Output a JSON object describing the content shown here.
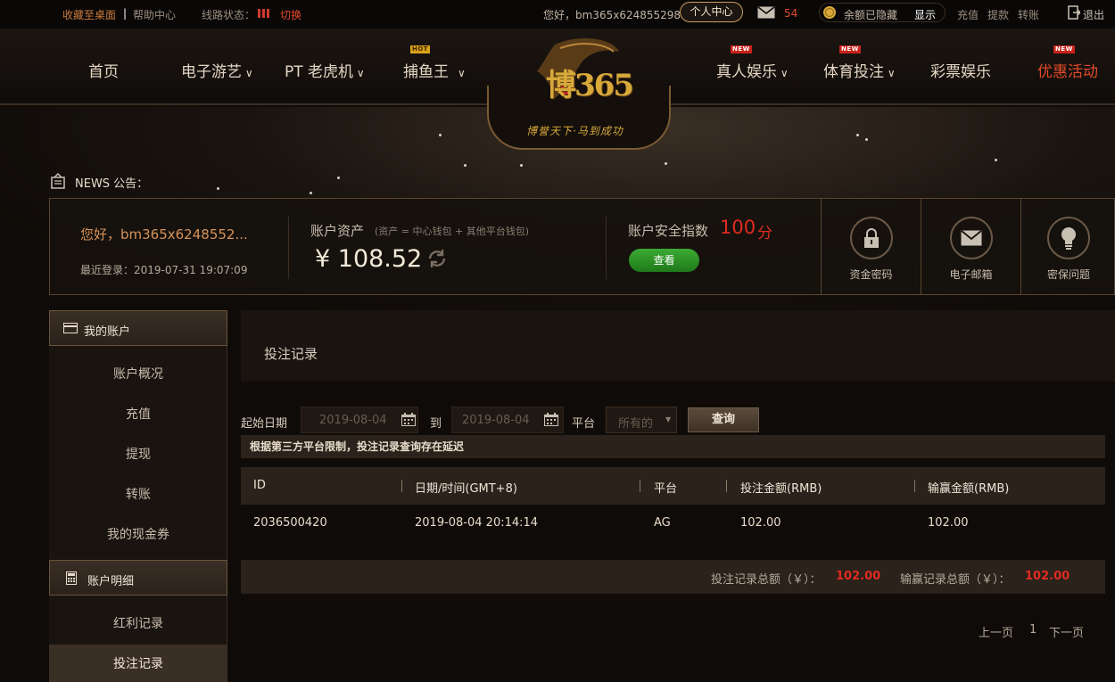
{
  "topbar": {
    "bookmark": "收藏至桌面",
    "help": "帮助中心",
    "line_status_label": "线路状态：",
    "switch": "切换",
    "greeting": "您好，bm365x624855298",
    "personal_center": "个人中心",
    "mail_count": "54",
    "balance_hidden": "余额已隐藏",
    "show": "显示",
    "deposit": "充值",
    "withdraw": "提款",
    "transfer": "转账",
    "logout": "退出"
  },
  "nav": {
    "home": "首页",
    "egames": "电子游艺",
    "pt_slots": "PT 老虎机",
    "fishing": "捕鱼王",
    "live": "真人娱乐",
    "sports": "体育投注",
    "lottery": "彩票娱乐",
    "promotions": "优惠活动",
    "hot_badge": "HOT",
    "new_badge": "NEW"
  },
  "logo": {
    "text": "博365",
    "slogan": "博誉天下·马到成功"
  },
  "news": {
    "label": "NEWS 公告："
  },
  "account": {
    "hello": "您好，bm365x6248552...",
    "last_login": "最近登录：2019-07-31 19:07:09",
    "assets_label": "账户资产",
    "assets_note": "(资产 = 中心钱包 + 其他平台钱包)",
    "assets_value": "¥ 108.52",
    "security_label": "账户安全指数",
    "security_score": "100",
    "security_unit": "分",
    "view_button": "查看"
  },
  "security_items": [
    {
      "label": "资金密码",
      "icon": "lock-icon"
    },
    {
      "label": "电子邮箱",
      "icon": "mail-icon"
    },
    {
      "label": "密保问题",
      "icon": "lightbulb-icon"
    }
  ],
  "sidebar": {
    "my_account": "我的账户",
    "items": [
      "账户概况",
      "充值",
      "提现",
      "转账",
      "我的现金券"
    ],
    "account_details": "账户明细",
    "detail_items": [
      "红利记录",
      "投注记录"
    ]
  },
  "main": {
    "title": "投注记录",
    "start_label": "起始日期",
    "start_date": "2019-08-04",
    "to_label": "到",
    "end_date": "2019-08-04",
    "platform_label": "平台",
    "platform_value": "所有的",
    "query_button": "查询",
    "notice": "根据第三方平台限制，投注记录查询存在延迟"
  },
  "table": {
    "headers": [
      "ID",
      "日期/时间(GMT+8)",
      "平台",
      "投注金额(RMB)",
      "输赢金额(RMB)"
    ],
    "rows": [
      [
        "2036500420",
        "2019-08-04 20:14:14",
        "AG",
        "102.00",
        "102.00"
      ]
    ],
    "bet_total_label": "投注记录总额（￥）：",
    "bet_total": "102.00",
    "win_total_label": "输赢记录总额（￥）：",
    "win_total": "102.00"
  },
  "pagination": {
    "prev": "上一页",
    "page": "1",
    "next": "下一页"
  },
  "colors": {
    "accent_red": "#e02b20",
    "gold": "#c9a15d",
    "green_button": "#2f8f2a"
  }
}
